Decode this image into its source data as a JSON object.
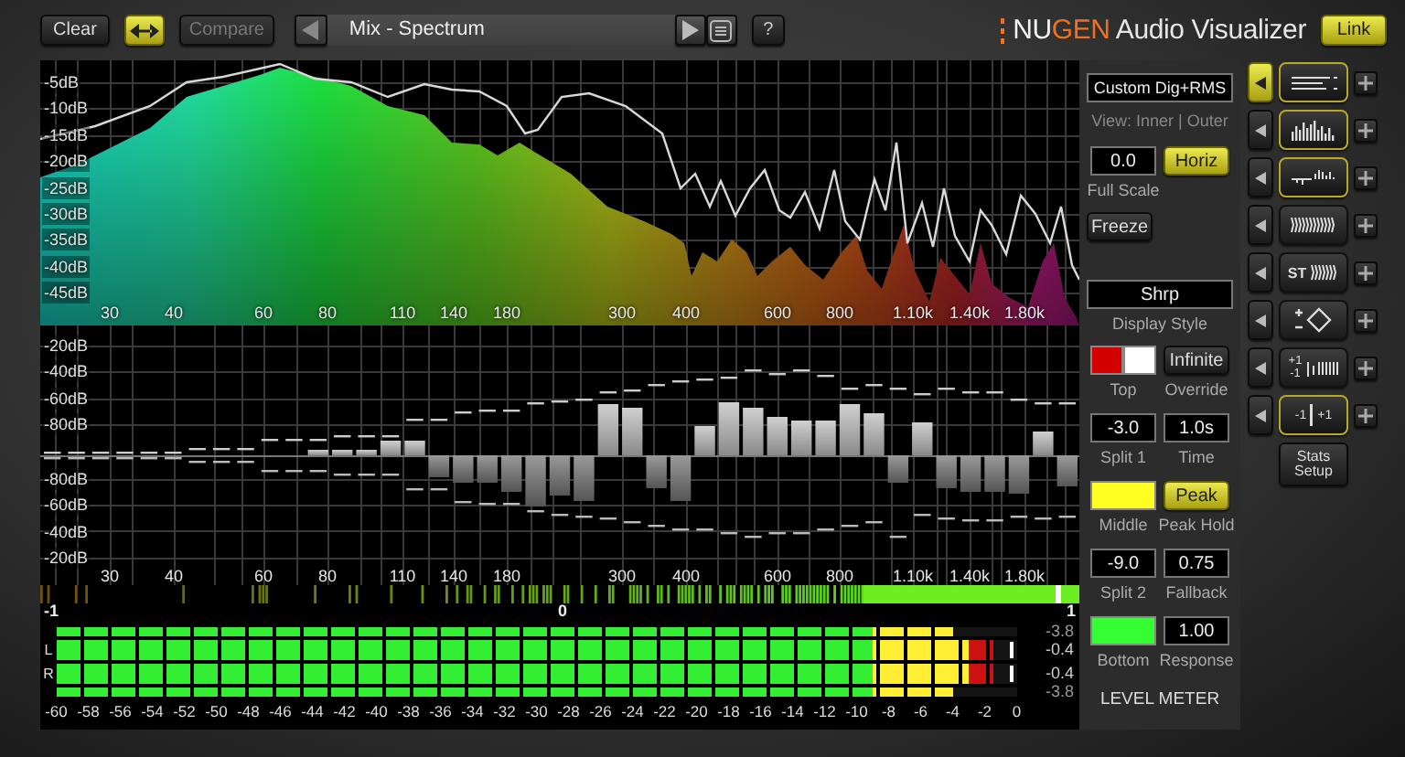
{
  "toolbar": {
    "clear_button": {
      "label": "Clear"
    },
    "link_arrows_button": {
      "on": true
    },
    "compare_button": {
      "label": "Compare",
      "disabled": true
    },
    "preset": {
      "value": "Mix - Spectrum"
    },
    "help_button": {
      "label": "?"
    }
  },
  "logo": {
    "brand_first": "NU",
    "brand_second": "GEN",
    "product": "Audio Visualizer"
  },
  "link_button": {
    "label": "Link",
    "on": true
  },
  "spectrum": {
    "y_labels": [
      "-5dB",
      "-10dB",
      "-15dB",
      "-20dB",
      "-25dB",
      "-30dB",
      "-35dB",
      "-40dB",
      "-45dB"
    ],
    "x_labels": [
      "30",
      "40",
      "60",
      "80",
      "110",
      "140",
      "180",
      "300",
      "400",
      "600",
      "800",
      "1.10k",
      "1.40k",
      "1.80k"
    ]
  },
  "bands": {
    "y_labels": [
      "-20dB",
      "-40dB",
      "-60dB",
      "-80dB",
      "-80dB",
      "-60dB",
      "-40dB",
      "-20dB"
    ],
    "x_labels": [
      "30",
      "40",
      "60",
      "80",
      "110",
      "140",
      "180",
      "300",
      "400",
      "600",
      "800",
      "1.10k",
      "1.40k",
      "1.80k"
    ]
  },
  "correlation": {
    "labels": [
      "-1",
      "0",
      "1"
    ]
  },
  "level_meter": {
    "rows": [
      {
        "kind": "thin",
        "level": 0.933,
        "reading": "-3.8"
      },
      {
        "kind": "main",
        "channel": "L",
        "level": 0.975,
        "reading": "-0.4",
        "peak": {
          "level": 0.993
        }
      },
      {
        "kind": "main",
        "channel": "R",
        "level": 0.975,
        "reading": "-0.4",
        "peak": {
          "level": 0.993
        }
      },
      {
        "kind": "thin",
        "level": 0.933,
        "reading": "-3.8"
      }
    ],
    "scale": [
      "-60",
      "-58",
      "-56",
      "-54",
      "-52",
      "-50",
      "-48",
      "-46",
      "-44",
      "-42",
      "-40",
      "-38",
      "-36",
      "-34",
      "-32",
      "-30",
      "-28",
      "-26",
      "-24",
      "-22",
      "-20",
      "-18",
      "-16",
      "-14",
      "-12",
      "-10",
      "-8",
      "-6",
      "-4",
      "-2",
      "0"
    ]
  },
  "display_settings": {
    "mode": {
      "value": "Custom Dig+RMS"
    },
    "view_label": "View: Inner | Outer",
    "full_scale": {
      "value": "0.0",
      "caption": "Full Scale"
    },
    "orientation_button": {
      "label": "Horiz",
      "on": true
    },
    "freeze_button": {
      "label": "Freeze",
      "on": false
    },
    "style": {
      "value": "Shrp",
      "caption": "Display Style"
    }
  },
  "meter_settings": {
    "items": [
      {
        "kind": "swatch",
        "color": "#d40000",
        "peak": {
          "color": "#ffffff"
        },
        "caption": "Top"
      },
      {
        "kind": "field",
        "value": "-3.0",
        "caption": "Split 1"
      },
      {
        "kind": "swatch",
        "color": "#ffff22",
        "caption": "Middle"
      },
      {
        "kind": "field",
        "value": "-9.0",
        "caption": "Split 2"
      },
      {
        "kind": "swatch",
        "color": "#33ff33",
        "caption": "Bottom"
      },
      {
        "kind": "button",
        "label": "Infinite",
        "on": false,
        "caption": "Override"
      },
      {
        "kind": "field",
        "value": "1.0s",
        "caption": "Time"
      },
      {
        "kind": "button",
        "label": "Peak",
        "on": true,
        "caption": "Peak Hold"
      },
      {
        "kind": "field",
        "value": "0.75",
        "caption": "Fallback"
      },
      {
        "kind": "field",
        "value": "1.00",
        "caption": "Response"
      }
    ],
    "title": "LEVEL METER"
  },
  "view_slots": [
    {
      "kind": "lines",
      "selected": true,
      "on": true
    },
    {
      "kind": "spectrum",
      "selected": false,
      "on": true
    },
    {
      "kind": "bipolar",
      "selected": false,
      "on": true
    },
    {
      "kind": "waves",
      "selected": false,
      "on": false
    },
    {
      "kind": "stereo",
      "selected": false,
      "on": false,
      "texts": [
        "ST"
      ]
    },
    {
      "kind": "diamond",
      "selected": false,
      "on": false
    },
    {
      "kind": "ticks",
      "selected": false,
      "on": false,
      "texts": [
        "+1",
        "-1"
      ]
    },
    {
      "kind": "correlation",
      "selected": false,
      "on": true,
      "texts": [
        "-1",
        "+1"
      ]
    }
  ],
  "stats_button": {
    "label": "Stats Setup"
  }
}
